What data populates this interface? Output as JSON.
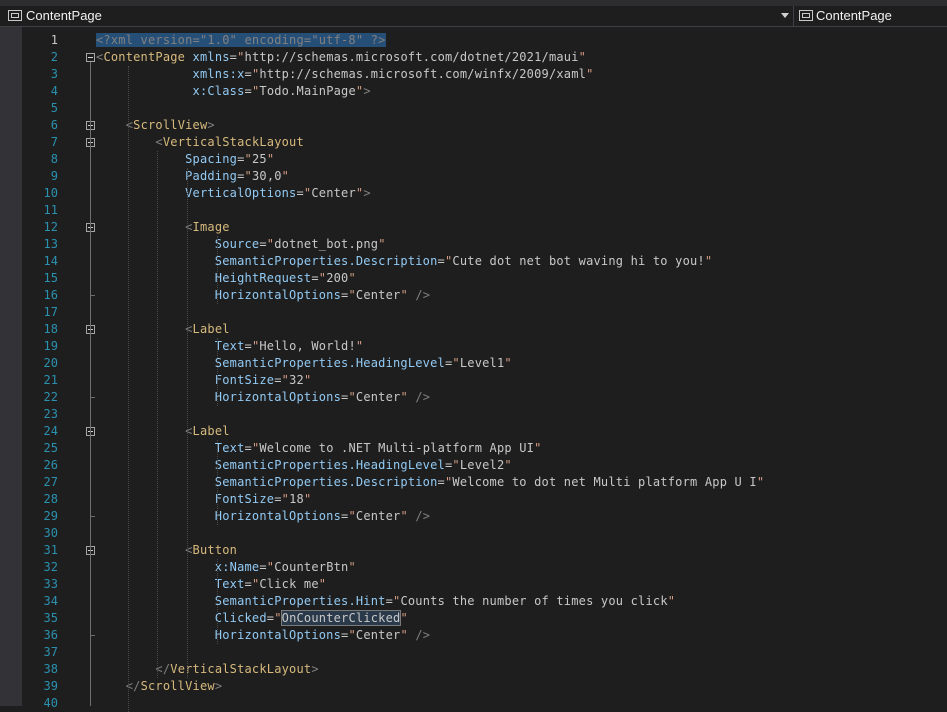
{
  "navbar": {
    "left_label": "ContentPage",
    "right_label": "ContentPage",
    "icons": [
      "xaml-element-icon",
      "chevron-down-icon"
    ]
  },
  "editor": {
    "current_line": 1,
    "lines": [
      {
        "n": "1",
        "text": "<?xml version=\"1.0\" encoding=\"utf-8\" ?>"
      },
      {
        "n": "2",
        "text": "<ContentPage xmlns=\"http://schemas.microsoft.com/dotnet/2021/maui\""
      },
      {
        "n": "3",
        "text": "             xmlns:x=\"http://schemas.microsoft.com/winfx/2009/xaml\""
      },
      {
        "n": "4",
        "text": "             x:Class=\"Todo.MainPage\">"
      },
      {
        "n": "5",
        "text": ""
      },
      {
        "n": "6",
        "text": "    <ScrollView>"
      },
      {
        "n": "7",
        "text": "        <VerticalStackLayout"
      },
      {
        "n": "8",
        "text": "            Spacing=\"25\""
      },
      {
        "n": "9",
        "text": "            Padding=\"30,0\""
      },
      {
        "n": "10",
        "text": "            VerticalOptions=\"Center\">"
      },
      {
        "n": "11",
        "text": ""
      },
      {
        "n": "12",
        "text": "            <Image"
      },
      {
        "n": "13",
        "text": "                Source=\"dotnet_bot.png\""
      },
      {
        "n": "14",
        "text": "                SemanticProperties.Description=\"Cute dot net bot waving hi to you!\""
      },
      {
        "n": "15",
        "text": "                HeightRequest=\"200\""
      },
      {
        "n": "16",
        "text": "                HorizontalOptions=\"Center\" />"
      },
      {
        "n": "17",
        "text": ""
      },
      {
        "n": "18",
        "text": "            <Label"
      },
      {
        "n": "19",
        "text": "                Text=\"Hello, World!\""
      },
      {
        "n": "20",
        "text": "                SemanticProperties.HeadingLevel=\"Level1\""
      },
      {
        "n": "21",
        "text": "                FontSize=\"32\""
      },
      {
        "n": "22",
        "text": "                HorizontalOptions=\"Center\" />"
      },
      {
        "n": "23",
        "text": ""
      },
      {
        "n": "24",
        "text": "            <Label"
      },
      {
        "n": "25",
        "text": "                Text=\"Welcome to .NET Multi-platform App UI\""
      },
      {
        "n": "26",
        "text": "                SemanticProperties.HeadingLevel=\"Level2\""
      },
      {
        "n": "27",
        "text": "                SemanticProperties.Description=\"Welcome to dot net Multi platform App U I\""
      },
      {
        "n": "28",
        "text": "                FontSize=\"18\""
      },
      {
        "n": "29",
        "text": "                HorizontalOptions=\"Center\" />"
      },
      {
        "n": "30",
        "text": ""
      },
      {
        "n": "31",
        "text": "            <Button"
      },
      {
        "n": "32",
        "text": "                x:Name=\"CounterBtn\""
      },
      {
        "n": "33",
        "text": "                Text=\"Click me\""
      },
      {
        "n": "34",
        "text": "                SemanticProperties.Hint=\"Counts the number of times you click\""
      },
      {
        "n": "35",
        "text": "                Clicked=\"OnCounterClicked\""
      },
      {
        "n": "36",
        "text": "                HorizontalOptions=\"Center\" />"
      },
      {
        "n": "37",
        "text": ""
      },
      {
        "n": "38",
        "text": "        </VerticalStackLayout>"
      },
      {
        "n": "39",
        "text": "    </ScrollView>"
      },
      {
        "n": "40",
        "text": ""
      }
    ]
  },
  "colors": {
    "background": "#1e1e1e",
    "line_number": "#2b91af",
    "element": "#d7ba7d",
    "attribute": "#92caf4",
    "quote": "#d69d85",
    "punctuation": "#808080",
    "selection": "#264f78"
  }
}
